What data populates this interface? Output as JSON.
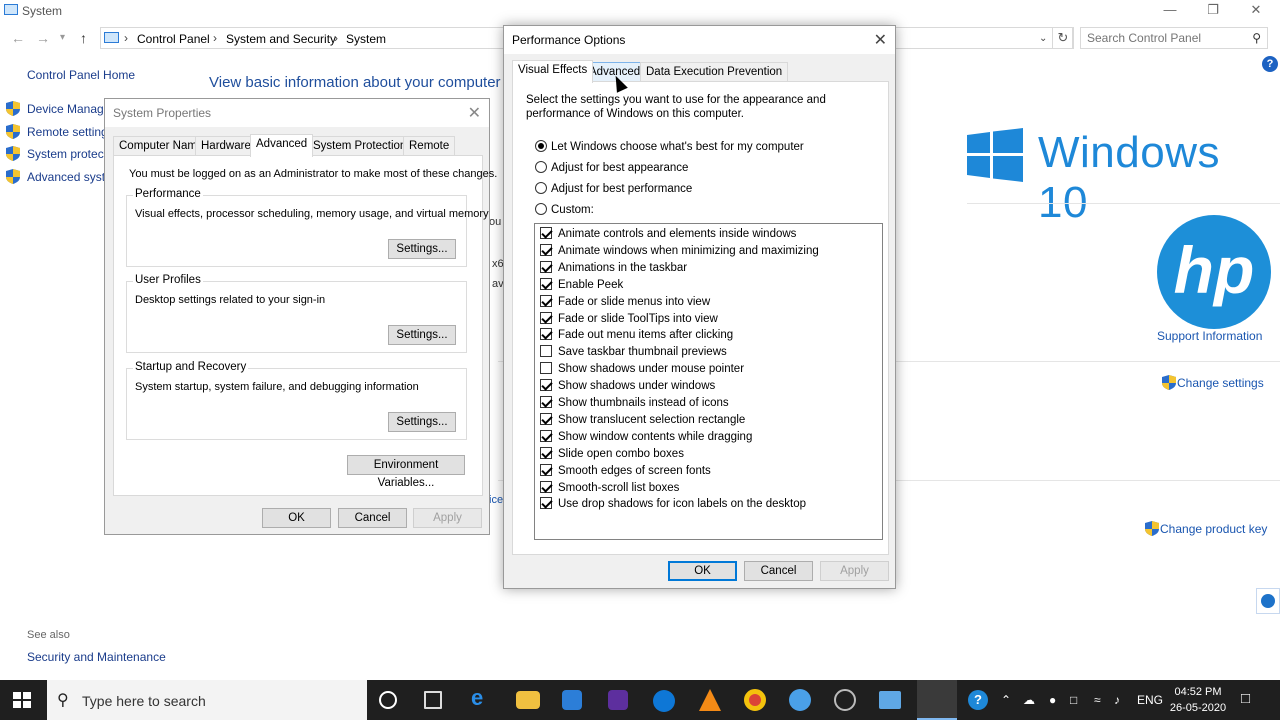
{
  "system_window": {
    "title": "System",
    "breadcrumbs": [
      "Control Panel",
      "System and Security",
      "System"
    ],
    "search_placeholder": "Search Control Panel",
    "left_nav": {
      "home": "Control Panel Home",
      "items": [
        "Device Manager",
        "Remote settings",
        "System protection",
        "Advanced system settings"
      ]
    },
    "heading": "View basic information about your computer",
    "partial_text": [
      "ou",
      "x6",
      "av",
      "ice"
    ],
    "windows_brand": "Windows 10",
    "hp_logo": "hp",
    "support_information": "Support Information",
    "change_settings": "Change settings",
    "change_product_key": "Change product key",
    "see_also": "See also",
    "security_and_maintenance": "Security and Maintenance"
  },
  "system_properties": {
    "title": "System Properties",
    "tabs": [
      "Computer Name",
      "Hardware",
      "Advanced",
      "System Protection",
      "Remote"
    ],
    "active_tab": "Advanced",
    "admin_note": "You must be logged on as an Administrator to make most of these changes.",
    "performance": {
      "label": "Performance",
      "description": "Visual effects, processor scheduling, memory usage, and virtual memory",
      "button": "Settings..."
    },
    "user_profiles": {
      "label": "User Profiles",
      "description": "Desktop settings related to your sign-in",
      "button": "Settings..."
    },
    "startup_recovery": {
      "label": "Startup and Recovery",
      "description": "System startup, system failure, and debugging information",
      "button": "Settings..."
    },
    "env_vars": "Environment Variables...",
    "ok": "OK",
    "cancel": "Cancel",
    "apply": "Apply"
  },
  "performance_options": {
    "title": "Performance Options",
    "tabs": [
      "Visual Effects",
      "Advanced",
      "Data Execution Prevention"
    ],
    "active_tab": "Visual Effects",
    "intro": [
      "Select the settings you want to use for the appearance and",
      "performance of Windows on this computer."
    ],
    "radios": [
      {
        "label": "Let Windows choose what's best for my computer",
        "checked": true
      },
      {
        "label": "Adjust for best appearance",
        "checked": false
      },
      {
        "label": "Adjust for best performance",
        "checked": false
      },
      {
        "label": "Custom:",
        "checked": false
      }
    ],
    "effects": [
      {
        "label": "Animate controls and elements inside windows",
        "checked": true
      },
      {
        "label": "Animate windows when minimizing and maximizing",
        "checked": true
      },
      {
        "label": "Animations in the taskbar",
        "checked": true
      },
      {
        "label": "Enable Peek",
        "checked": true
      },
      {
        "label": "Fade or slide menus into view",
        "checked": true
      },
      {
        "label": "Fade or slide ToolTips into view",
        "checked": true
      },
      {
        "label": "Fade out menu items after clicking",
        "checked": true
      },
      {
        "label": "Save taskbar thumbnail previews",
        "checked": false
      },
      {
        "label": "Show shadows under mouse pointer",
        "checked": false
      },
      {
        "label": "Show shadows under windows",
        "checked": true
      },
      {
        "label": "Show thumbnails instead of icons",
        "checked": true
      },
      {
        "label": "Show translucent selection rectangle",
        "checked": true
      },
      {
        "label": "Show window contents while dragging",
        "checked": true
      },
      {
        "label": "Slide open combo boxes",
        "checked": true
      },
      {
        "label": "Smooth edges of screen fonts",
        "checked": true
      },
      {
        "label": "Smooth-scroll list boxes",
        "checked": true
      },
      {
        "label": "Use drop shadows for icon labels on the desktop",
        "checked": true
      }
    ],
    "ok": "OK",
    "cancel": "Cancel",
    "apply": "Apply"
  },
  "taskbar": {
    "search_placeholder": "Type here to search",
    "language": "ENG",
    "time": "04:52 PM",
    "date": "26-05-2020",
    "apps": [
      "cortana-icon",
      "task-view-icon",
      "edge-icon",
      "file-explorer-icon",
      "store-icon",
      "app-x-icon",
      "teamviewer-icon",
      "vlc-icon",
      "chrome-icon",
      "app-blue-icon",
      "app-dark-icon",
      "app-window-icon",
      "app-active-icon"
    ]
  },
  "colors": {
    "link": "#1a3c8b",
    "accent": "#0078d7",
    "windows_blue": "#1e88d8",
    "hp_blue": "#1d8fd8",
    "taskbar": "#1f1f1f"
  }
}
